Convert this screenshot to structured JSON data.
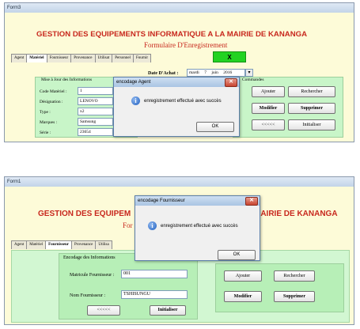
{
  "top": {
    "window_title": "Form3",
    "banner": "GESTION DES EQUIPEMENTS INFORMATIQUE A LA MAIRIE DE KANANGA",
    "subtitle": "Formulaire D'Enregistrement",
    "close_x": "X",
    "tabs": [
      "Agent",
      "Matériel",
      "Fournisseur",
      "Provenance",
      "Utilisat",
      "Personnel",
      "Fournir"
    ],
    "active_tab": 1,
    "date_label": "Date D'Achat :",
    "date_day": "mardi",
    "date_num": "7",
    "date_month": "juin",
    "date_year": "2016",
    "section_title": "Mise à Jour des Informations",
    "commands_title": "Commandes",
    "fields": [
      {
        "label": "Code Matériel :",
        "value": "1"
      },
      {
        "label": "Désignation :",
        "value": "LENOVO"
      },
      {
        "label": "Type :",
        "value": "x2"
      },
      {
        "label": "Marques :",
        "value": "Samsung"
      },
      {
        "label": "Série :",
        "value": "23654"
      }
    ],
    "buttons": {
      "ajouter": "Ajouter",
      "rechercher": "Rechercher",
      "modifier": "Modifier",
      "supprimer": "Supprimer",
      "prev": "<<<<<",
      "initialiser": "Initialiser"
    },
    "dialog": {
      "title": "encodage Agent",
      "message": "enregistrement effectué avec succès",
      "ok": "OK"
    }
  },
  "bottom": {
    "window_title": "Form1",
    "banner_left": "GESTION DES EQUIPEM",
    "banner_right": "MAIRIE DE KANANGA",
    "subtitle_fragment": "For",
    "tabs": [
      "Agent",
      "Matériel",
      "Fournisseur",
      "Provenance",
      "Utilisa"
    ],
    "active_tab": 2,
    "section_title": "Encodage des Informations",
    "fields": [
      {
        "label": "Matricule Fournisseur :",
        "value": "001"
      },
      {
        "label": "Nom Fournisseur :",
        "value": "TSHISUNGU"
      }
    ],
    "buttons": {
      "ajouter": "Ajouter",
      "rechercher": "Rechercher",
      "modifier": "Modifier",
      "supprimer": "Supprimer",
      "prev": "<<<<<",
      "initialiser": "Initialiser"
    },
    "dialog": {
      "title": "encodage Fournisseur",
      "message": "enregistrement effectué avec succès",
      "ok": "OK"
    }
  }
}
